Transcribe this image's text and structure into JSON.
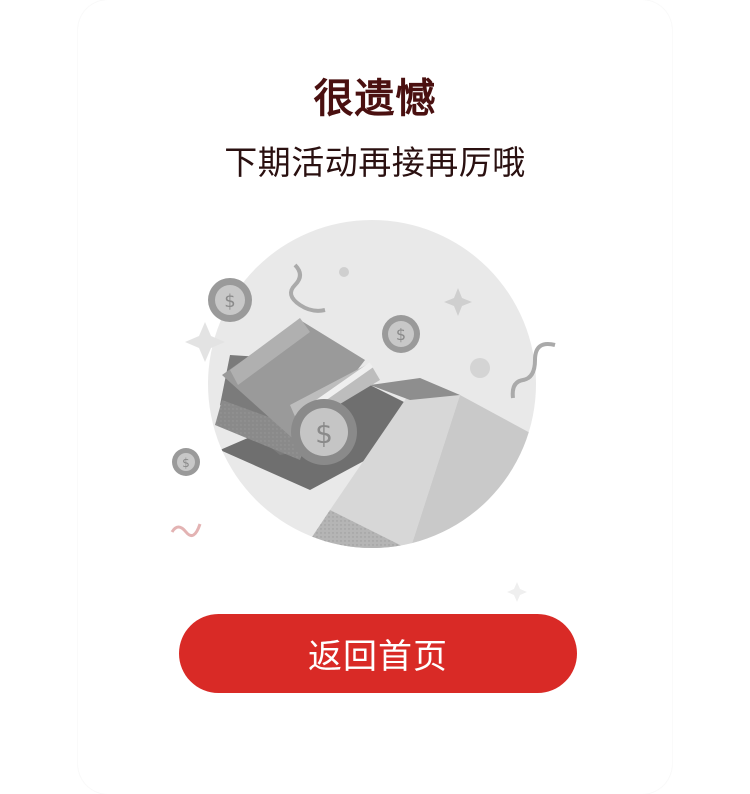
{
  "result": {
    "title": "很遗憾",
    "subtitle": "下期活动再接再厉哦"
  },
  "actions": {
    "home_label": "返回首页"
  },
  "colors": {
    "title": "#4a1010",
    "button": "#d92a26",
    "illustration_tone": "grayscale"
  },
  "illustration": {
    "icon": "empty-wallet-coins-illustration"
  }
}
